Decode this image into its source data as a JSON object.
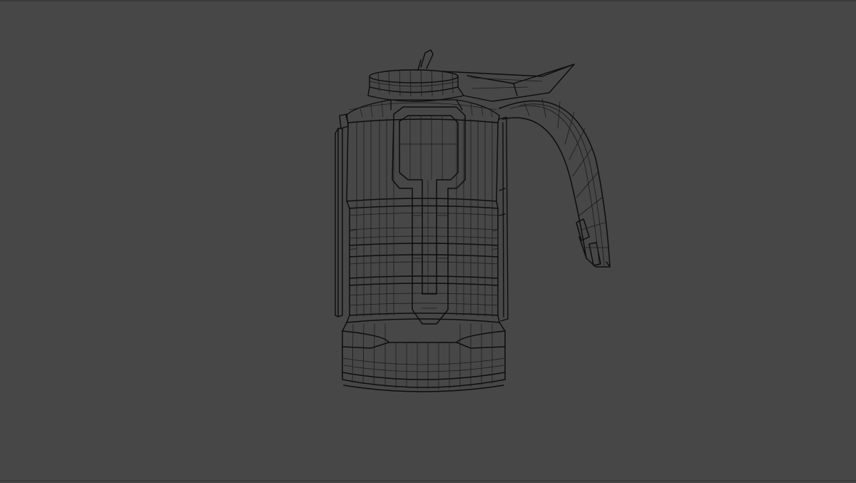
{
  "viewport": {
    "background": "#474747",
    "wire_color": "#0d0d0d",
    "wire_fine_color": "#1a1a1a",
    "mode": "wireframe"
  },
  "model": {
    "object": "pitcher-icon"
  }
}
